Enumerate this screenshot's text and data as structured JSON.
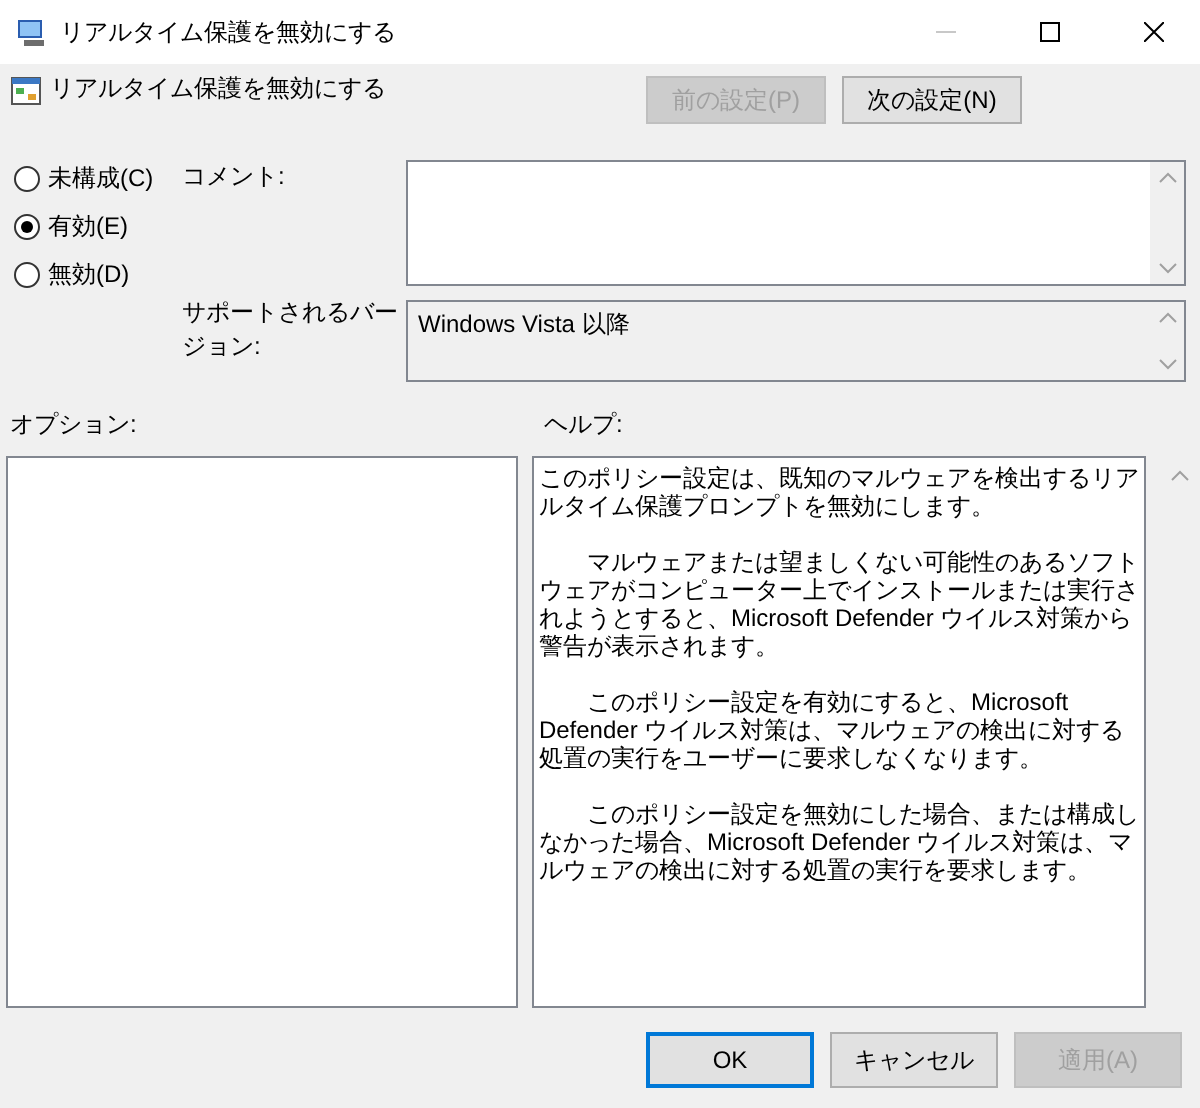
{
  "window": {
    "title": "リアルタイム保護を無効にする"
  },
  "header": {
    "title": "リアルタイム保護を無効にする"
  },
  "nav_buttons": [
    {
      "label": "前の設定(P)",
      "disabled": true
    },
    {
      "label": "次の設定(N)",
      "disabled": false
    }
  ],
  "radios": [
    {
      "label": "未構成(C)",
      "selected": false
    },
    {
      "label": "有効(E)",
      "selected": true
    },
    {
      "label": "無効(D)",
      "selected": false
    }
  ],
  "comment": {
    "label": "コメント:"
  },
  "supported": {
    "label": "サポートされるバージョン:",
    "value": "Windows Vista 以降"
  },
  "options": {
    "label": "オプション:"
  },
  "help": {
    "label": "ヘルプ:",
    "paragraphs": [
      "このポリシー設定は、既知のマルウェアを検出するリアルタイム保護プロンプトを無効にします。",
      "マルウェアまたは望ましくない可能性のあるソフトウェアがコンピューター上でインストールまたは実行されようとすると、Microsoft Defender ウイルス対策から警告が表示されます。",
      "このポリシー設定を有効にすると、Microsoft Defender ウイルス対策は、マルウェアの検出に対する処置の実行をユーザーに要求しなくなります。",
      "このポリシー設定を無効にした場合、または構成しなかった場合、Microsoft Defender ウイルス対策は、マルウェアの検出に対する処置の実行を要求します。"
    ]
  },
  "buttons": [
    {
      "label": "OK",
      "disabled": false,
      "default": true
    },
    {
      "label": "キャンセル",
      "disabled": false,
      "default": false
    },
    {
      "label": "適用(A)",
      "disabled": true,
      "default": false
    }
  ]
}
